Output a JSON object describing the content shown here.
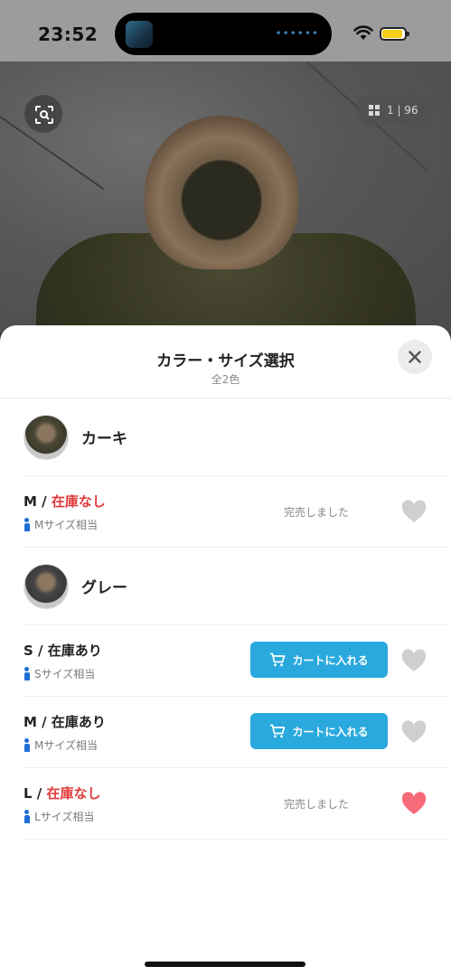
{
  "status_bar": {
    "time": "23:52",
    "island_indicator": "••••••"
  },
  "photo": {
    "counter": "1 | 96"
  },
  "sheet": {
    "title": "カラー・サイズ選択",
    "subtitle": "全2色"
  },
  "colors": [
    {
      "name": "カーキ",
      "sizes": [
        {
          "size": "M /",
          "stock": "在庫なし",
          "fit": "Mサイズ相当",
          "action": "完売しました",
          "favorited": false
        }
      ]
    },
    {
      "name": "グレー",
      "sizes": [
        {
          "size": "S /",
          "stock": "在庫あり",
          "fit": "Sサイズ相当",
          "action": "カートに入れる",
          "favorited": false
        },
        {
          "size": "M /",
          "stock": "在庫あり",
          "fit": "Mサイズ相当",
          "action": "カートに入れる",
          "favorited": false
        },
        {
          "size": "L /",
          "stock": "在庫なし",
          "fit": "Lサイズ相当",
          "action": "完売しました",
          "favorited": true
        }
      ]
    }
  ],
  "theme": {
    "accent": "#29a9dd",
    "out_of_stock": "#e03a3a",
    "heart_active": "#f76a7a",
    "heart_inactive": "#cfcfcf"
  }
}
